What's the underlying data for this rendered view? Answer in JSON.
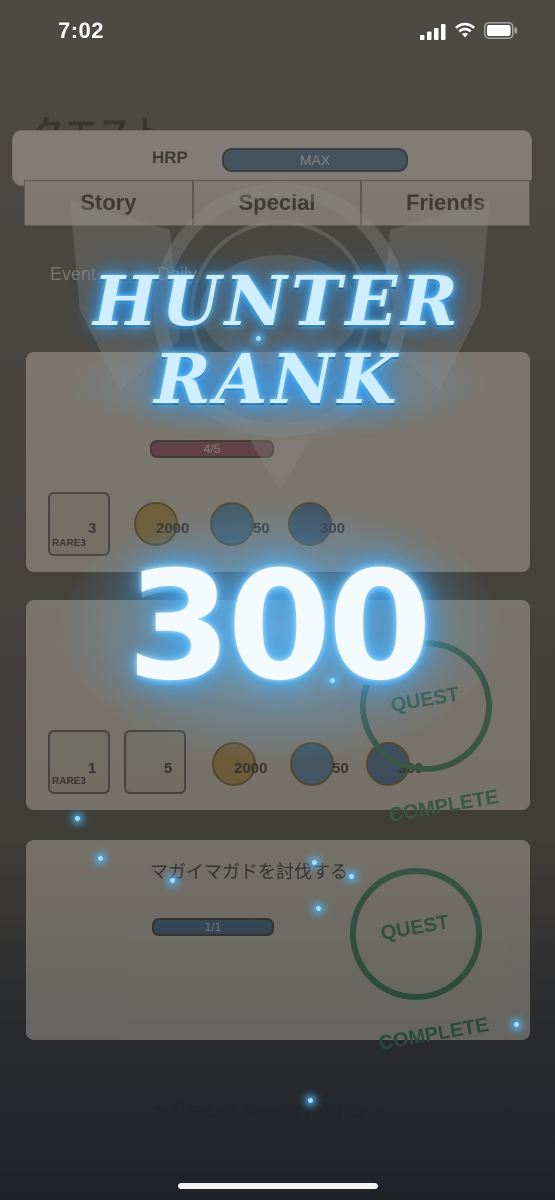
{
  "status_bar": {
    "time": "7:02"
  },
  "background_screen": {
    "title": "クエスト",
    "hrp_label": "HRP",
    "hrp_gauge": "MAX",
    "tabs": [
      "Story",
      "Special",
      "Friends"
    ],
    "subtabs": [
      "Event",
      "Daily"
    ],
    "quest1": {
      "progress": "4/5",
      "rarity": "RARE3",
      "item_count": "3",
      "zenny": "2000",
      "points": "50",
      "pass": "300"
    },
    "quest2": {
      "rarity": "RARE3",
      "item_count_a": "1",
      "item_count_b": "5",
      "zenny": "2000",
      "points": "50",
      "pass": "300",
      "stamp": "QUEST COMPLETE"
    },
    "quest3": {
      "name": "マガイマガドを討伐する",
      "progress": "1/1",
      "stamp": "QUEST COMPLETE"
    },
    "quest4": {
      "name": "大型モンスターを討伐する"
    }
  },
  "overlay": {
    "title_line1": "HUNTER",
    "title_line2": "RANK",
    "rank_value": "300"
  },
  "colors": {
    "glow": "#4fb8ff",
    "text": "#f4fbff"
  },
  "icons": [
    "cellular-signal-icon",
    "wifi-icon",
    "battery-icon",
    "hunter-emblem-icon"
  ]
}
